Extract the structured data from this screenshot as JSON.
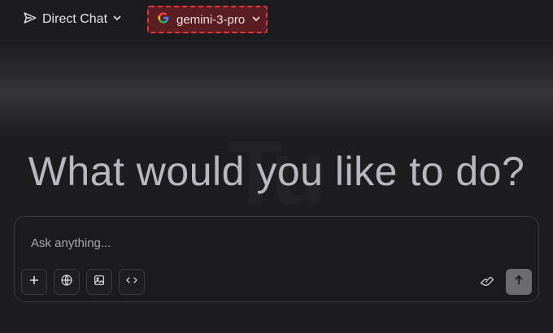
{
  "header": {
    "mode_label": "Direct Chat",
    "model_label": "gemini-3-pro"
  },
  "hero": {
    "headline": "What would you like to do?",
    "watermark": "Tu"
  },
  "composer": {
    "placeholder": "Ask anything..."
  },
  "icons": {
    "mode": "send-icon",
    "mode_chevron": "chevron-down-icon",
    "model": "google-icon",
    "model_chevron": "chevron-down-icon",
    "add": "plus-icon",
    "web": "globe-icon",
    "image": "image-icon",
    "code": "code-icon",
    "tools": "hand-icon",
    "send": "arrow-up-icon"
  },
  "colors": {
    "background": "#1d1d20",
    "highlight_border": "#e2373f",
    "highlight_fill": "#5a1d22",
    "send_button": "#6b6b70"
  }
}
